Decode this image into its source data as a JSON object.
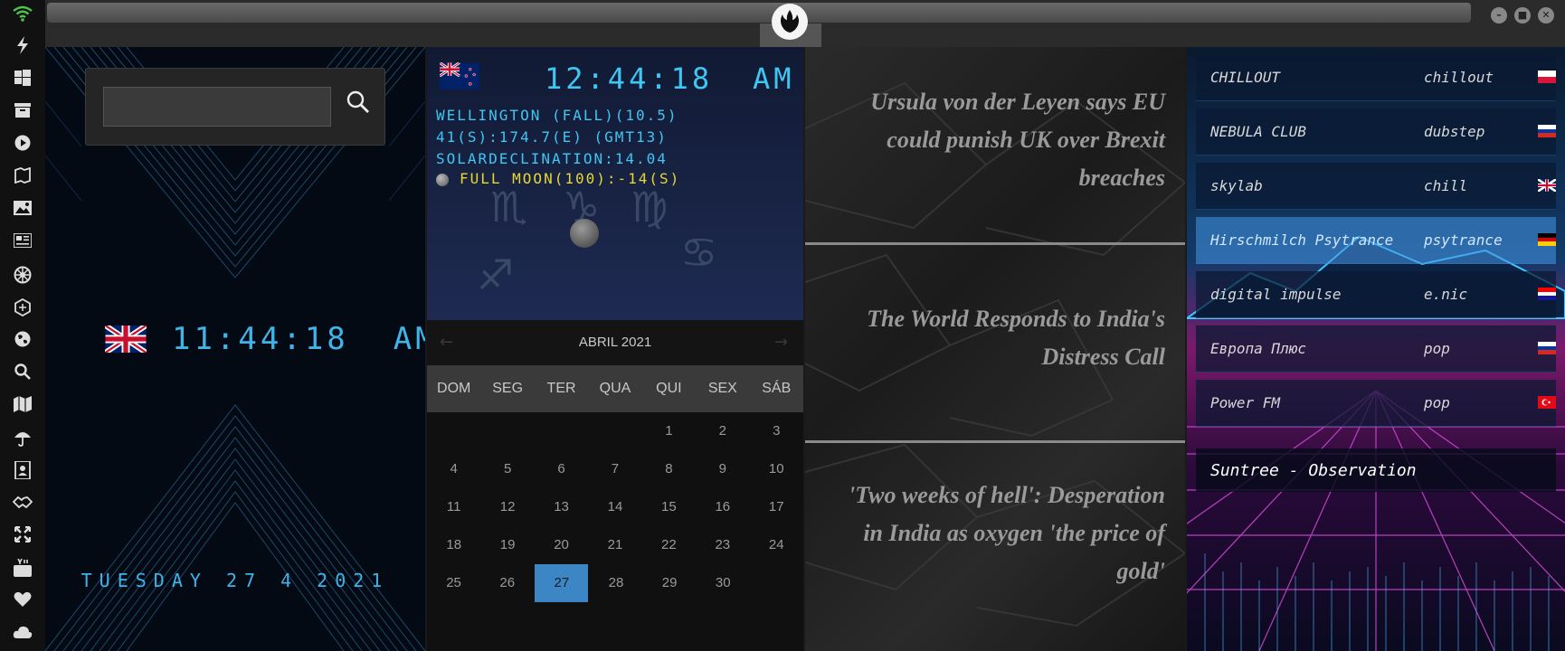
{
  "sidebar": {
    "icons": [
      "wifi-icon",
      "lightning-icon",
      "windows-icon",
      "archive-icon",
      "play-icon",
      "map-book-icon",
      "image-icon",
      "news-icon",
      "settings-wheel-icon",
      "hexagon-icon",
      "globe-icon",
      "search-icon",
      "map-icon",
      "umbrella-icon",
      "contacts-icon",
      "handshake-icon",
      "expand-icon",
      "youtube-icon",
      "heart-icon",
      "cloud-icon"
    ]
  },
  "window": {
    "buttons": {
      "minimize": "–",
      "maximize": "■",
      "close": "✕"
    }
  },
  "uk_clock": {
    "search_placeholder": "",
    "time": "11:44:18",
    "ampm": "AM",
    "date": "TUESDAY 27 4 2021",
    "flag": "uk-flag"
  },
  "nz_clock": {
    "time": "12:44:18",
    "ampm": "AM",
    "location": "WELLINGTON (FALL)(10.5)",
    "coords": "41(S):174.7(E) (GMT13)",
    "solar": "SOLARDECLINATION:14.04",
    "moon": "FULL MOON(100):-14(S)",
    "flag": "nz-flag"
  },
  "calendar": {
    "month_label": "ABRIL 2021",
    "prev": "←",
    "next": "→",
    "weekdays": [
      "DOM",
      "SEG",
      "TER",
      "QUA",
      "QUI",
      "SEX",
      "SÁB"
    ],
    "weeks": [
      [
        "",
        "",
        "",
        "",
        "1",
        "2",
        "3"
      ],
      [
        "4",
        "5",
        "6",
        "7",
        "8",
        "9",
        "10"
      ],
      [
        "11",
        "12",
        "13",
        "14",
        "15",
        "16",
        "17"
      ],
      [
        "18",
        "19",
        "20",
        "21",
        "22",
        "23",
        "24"
      ],
      [
        "25",
        "26",
        "27",
        "28",
        "29",
        "30",
        ""
      ]
    ],
    "today": "27"
  },
  "news": [
    {
      "text": "Ursula von der Leyen says EU could punish UK over Brexit breaches"
    },
    {
      "text": "The World Responds to India's Distress Call"
    },
    {
      "text": "'Two weeks of hell': Desperation in India as oxygen 'the price of gold'"
    }
  ],
  "radio": {
    "stations": [
      {
        "name": "CHILLOUT",
        "genre": "chillout",
        "flag": "poland-flag"
      },
      {
        "name": "NEBULA CLUB",
        "genre": "dubstep",
        "flag": "russia-flag"
      },
      {
        "name": "skylab",
        "genre": "chill",
        "flag": "uk-flag"
      },
      {
        "name": "Hirschmilch Psytrance",
        "genre": "psytrance",
        "flag": "germany-flag"
      },
      {
        "name": "digital impulse",
        "genre": "e.nic",
        "flag": "croatia-flag"
      },
      {
        "name": "Европа Плюс",
        "genre": "pop",
        "flag": "russia-flag"
      },
      {
        "name": "Power FM",
        "genre": "pop",
        "flag": "turkey-flag"
      }
    ],
    "active_station": 3,
    "now_playing": "Suntree - Observation"
  },
  "colors": {
    "clock_blue": "#3fb4e8",
    "moon_yellow": "#e6d832",
    "calendar_today": "#3d86c6",
    "sidebar_bg": "#111111"
  }
}
